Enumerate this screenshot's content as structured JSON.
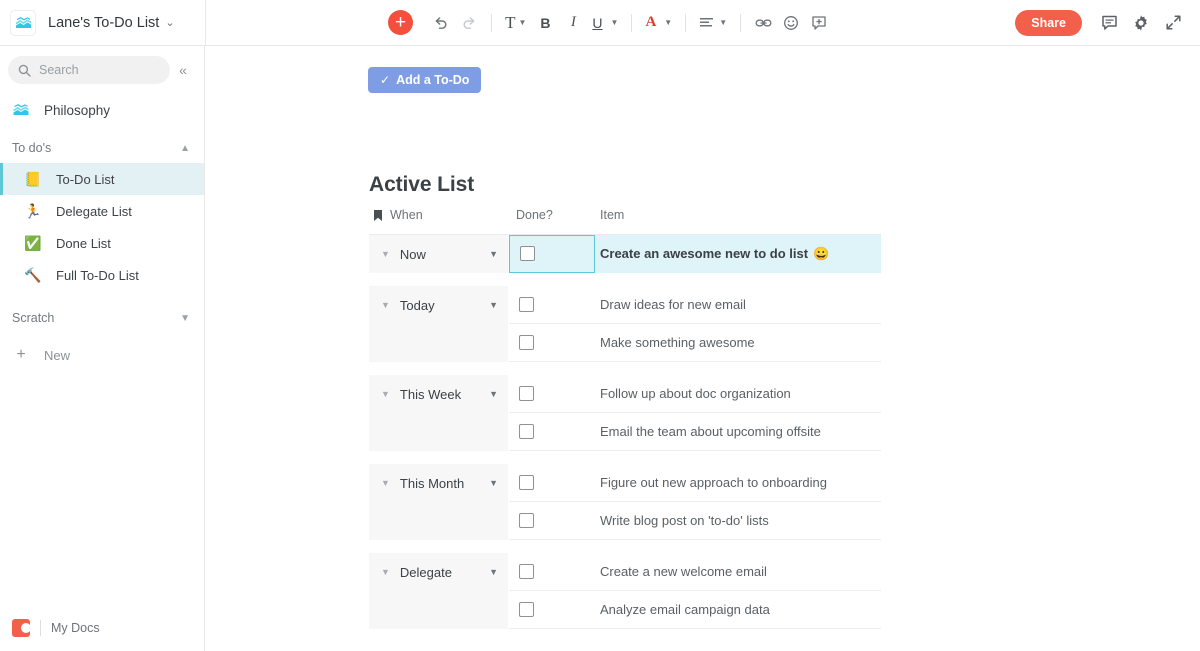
{
  "topbar": {
    "doc_icon": "books-icon",
    "doc_title": "Lane's To-Do List",
    "title_caret": "⌄",
    "share_label": "Share",
    "tools": [
      {
        "name": "add-button",
        "glyph": "+",
        "caret": false
      },
      {
        "name": "undo-button",
        "glyph": "↶",
        "caret": false
      },
      {
        "name": "redo-button",
        "glyph": "↷",
        "caret": false
      },
      {
        "name": "text-style-button",
        "glyph": "T",
        "caret": true
      },
      {
        "name": "bold-button",
        "glyph": "B",
        "caret": false
      },
      {
        "name": "italic-button",
        "glyph": "I",
        "caret": false
      },
      {
        "name": "underline-button",
        "glyph": "U",
        "caret": true
      },
      {
        "name": "text-color-button",
        "glyph": "A",
        "caret": true
      },
      {
        "name": "align-button",
        "glyph": "≡",
        "caret": true
      },
      {
        "name": "link-button",
        "glyph": "⚭",
        "caret": false
      },
      {
        "name": "emoji-button",
        "glyph": "☺",
        "caret": false
      },
      {
        "name": "insert-button",
        "glyph": "⊞",
        "caret": false
      }
    ],
    "right_icons": [
      {
        "name": "comment-icon",
        "glyph": "▤"
      },
      {
        "name": "settings-gear-icon",
        "glyph": "⚙"
      },
      {
        "name": "expand-icon",
        "glyph": "⤡"
      }
    ]
  },
  "sidebar": {
    "search_placeholder": "Search",
    "collapse_glyph": "«",
    "top_nav": {
      "icon": "books-icon",
      "label": "Philosophy"
    },
    "sections": [
      {
        "label": "To do's",
        "caret": "⌃",
        "expanded": true,
        "items": [
          {
            "label": "To-Do List",
            "icon": "📒",
            "active": true
          },
          {
            "label": "Delegate List",
            "icon": "🏃",
            "active": false
          },
          {
            "label": "Done List",
            "icon": "✅",
            "active": false
          },
          {
            "label": "Full To-Do List",
            "icon": "🔨",
            "active": false
          }
        ]
      },
      {
        "label": "Scratch",
        "caret": "⌄",
        "expanded": false,
        "items": []
      }
    ],
    "new_label": "New",
    "new_glyph": "+",
    "footer": {
      "label": "My Docs",
      "logo_color": "#f2604c"
    }
  },
  "main": {
    "add_todo_label": "Add a To-Do",
    "add_todo_check": "✓",
    "page_title": "Active List",
    "table": {
      "columns": [
        {
          "key": "when",
          "label": "When",
          "icon": "bookmark-icon"
        },
        {
          "key": "done",
          "label": "Done?"
        },
        {
          "key": "item",
          "label": "Item"
        }
      ],
      "groups": [
        {
          "when": "Now",
          "rows": [
            {
              "item": "Create an awesome new to do list",
              "emoji": "😀",
              "done": false,
              "selected": true
            }
          ]
        },
        {
          "when": "Today",
          "rows": [
            {
              "item": "Draw ideas for new email",
              "emoji": "",
              "done": false,
              "selected": false
            },
            {
              "item": "Make something awesome",
              "emoji": "",
              "done": false,
              "selected": false
            }
          ]
        },
        {
          "when": "This Week",
          "rows": [
            {
              "item": "Follow up about doc organization",
              "emoji": "",
              "done": false,
              "selected": false
            },
            {
              "item": "Email the team about upcoming offsite",
              "emoji": "",
              "done": false,
              "selected": false
            }
          ]
        },
        {
          "when": "This Month",
          "rows": [
            {
              "item": "Figure out new approach to onboarding",
              "emoji": "",
              "done": false,
              "selected": false
            },
            {
              "item": "Write blog post on 'to-do' lists",
              "emoji": "",
              "done": false,
              "selected": false
            }
          ]
        },
        {
          "when": "Delegate",
          "rows": [
            {
              "item": "Create a new welcome email",
              "emoji": "",
              "done": false,
              "selected": false
            },
            {
              "item": "Analyze email campaign data",
              "emoji": "",
              "done": false,
              "selected": false
            }
          ]
        }
      ]
    }
  },
  "colors": {
    "accent_red": "#f2503c",
    "share_red": "#f2604c",
    "button_blue": "#7e9de4",
    "selection_cyan": "#5ec7d6",
    "selection_bg": "#dff4f8",
    "active_nav_bg": "#e3f1f4",
    "group_bg": "#f7f7f7"
  }
}
